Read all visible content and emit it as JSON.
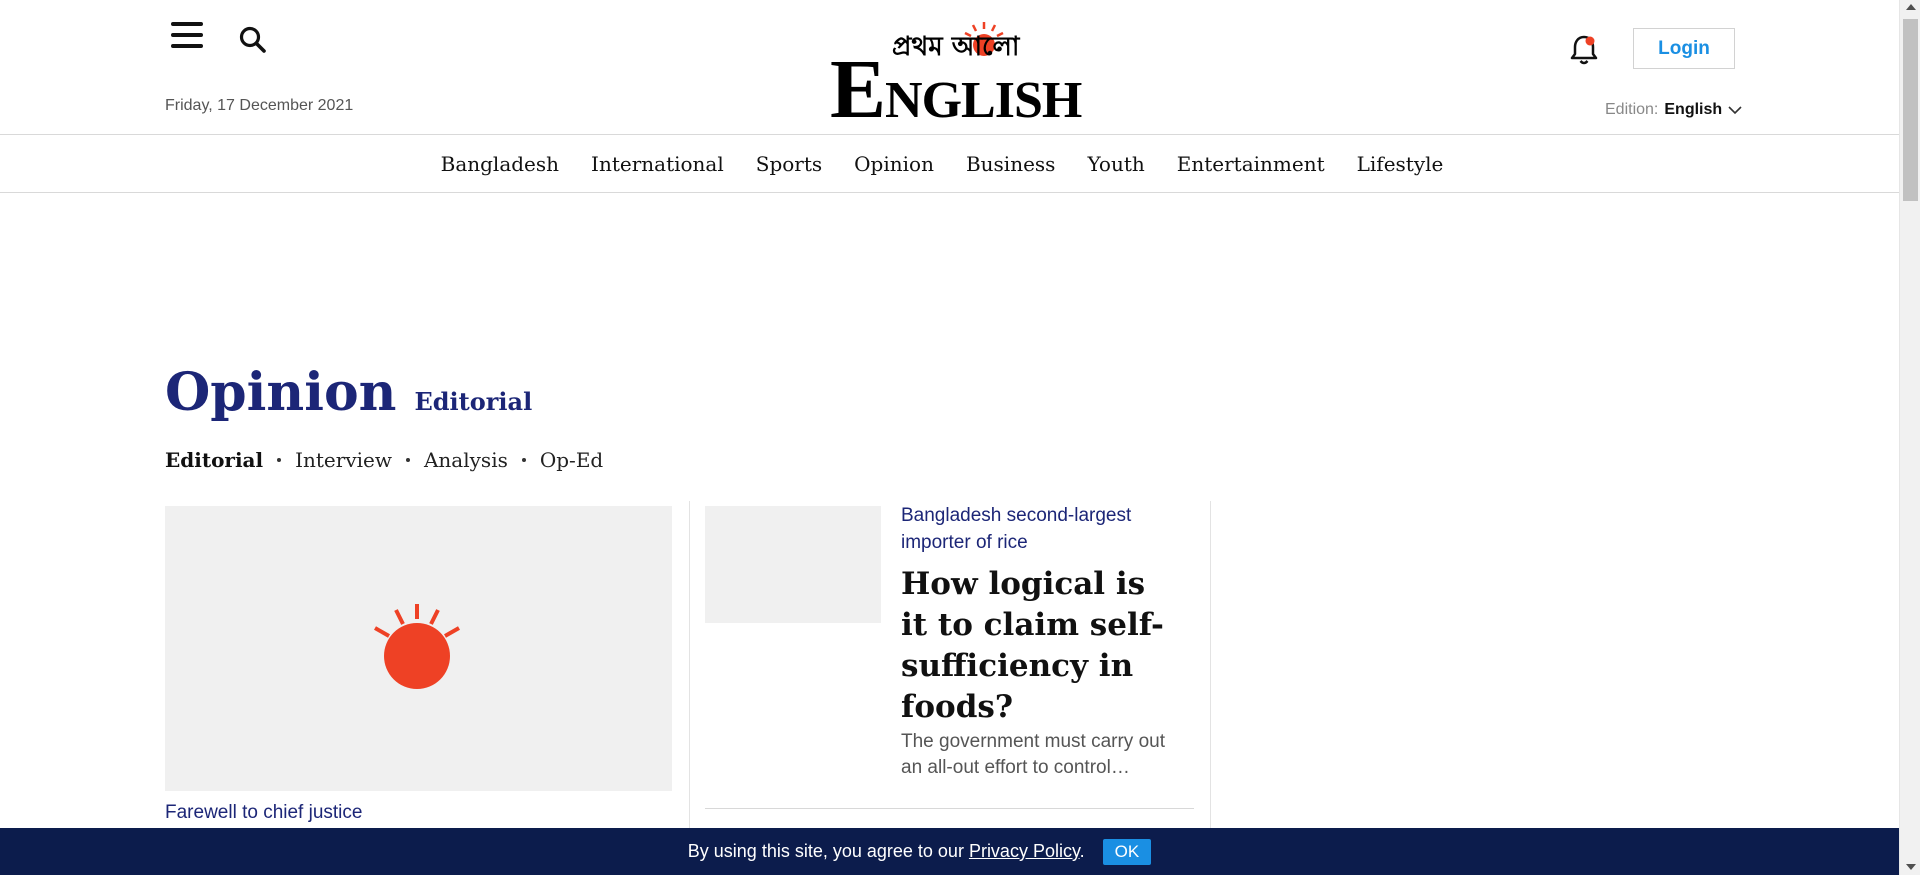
{
  "header": {
    "date": "Friday, 17 December 2021",
    "logo_text": "ENGLISH",
    "logo_bangla": "প্রথম আলো",
    "login_label": "Login",
    "edition_label": "Edition:",
    "edition_value": "English"
  },
  "nav": {
    "items": [
      "Bangladesh",
      "International",
      "Sports",
      "Opinion",
      "Business",
      "Youth",
      "Entertainment",
      "Lifestyle"
    ]
  },
  "section": {
    "title": "Opinion",
    "subtitle": "Editorial",
    "subnav": [
      "Editorial",
      "Interview",
      "Analysis",
      "Op-Ed"
    ]
  },
  "lead_story": {
    "kicker": "Farewell to chief justice"
  },
  "second_story": {
    "kicker": "Bangladesh second-largest importer of rice",
    "headline": "How logical is it to claim self-sufficiency in foods?",
    "summary": "The government must carry out an all-out effort to control…"
  },
  "cookie": {
    "text_before": "By using this site, you agree to our ",
    "link": "Privacy Policy",
    "text_after": ".",
    "ok_label": "OK"
  },
  "colors": {
    "brand_navy": "#1c2677",
    "sun_red": "#ee4125",
    "link_blue": "#1a8fe3",
    "cookie_bg": "#0c1c4c"
  },
  "icons": {
    "menu": "hamburger-icon",
    "search": "search-icon",
    "notifications": "bell-icon",
    "edition_dropdown": "chevron-down-icon",
    "placeholder": "sun-logo-icon"
  }
}
